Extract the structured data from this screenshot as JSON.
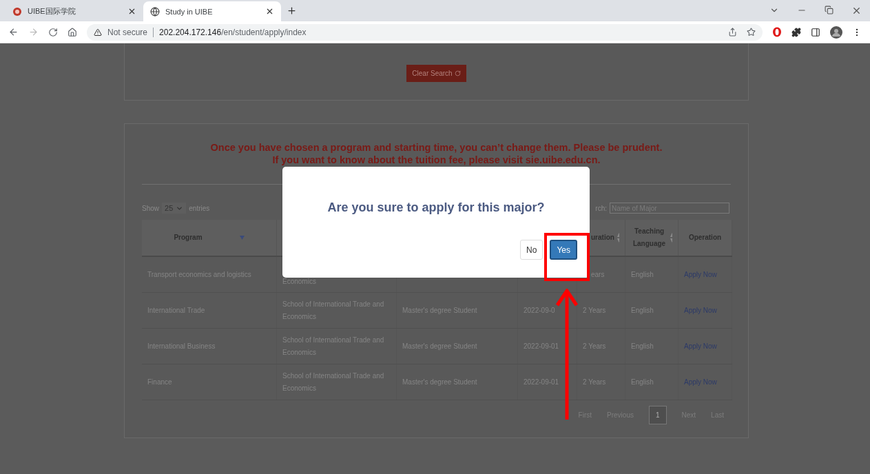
{
  "browser": {
    "tabs": [
      {
        "title": "UIBE国际学院",
        "selected": false
      },
      {
        "title": "Study in UIBE",
        "selected": true
      }
    ],
    "address": {
      "security": "Not secure",
      "host": "202.204.172.146",
      "path": "/en/student/apply/index"
    }
  },
  "page": {
    "clear_button": "Clear Search",
    "notice": [
      "Once you have chosen a program and starting time, you can’t change them. Please be prudent.",
      "If you want to know about the tuition fee, please visit sie.uibe.edu.cn."
    ],
    "controls": {
      "show_label": "Show",
      "page_length": "25",
      "entries_label": "entries",
      "search_label": "rch:",
      "search_placeholder": "Name of Major"
    },
    "columns": [
      {
        "label": "Program",
        "sorted": true
      },
      {},
      {},
      {},
      {
        "label": "uration",
        "sorted": false
      },
      {
        "label": "Teaching Language",
        "sorted": false
      },
      {
        "label": "Operation"
      }
    ],
    "rows": [
      [
        "Transport economics and logistics",
        "Economics",
        null,
        null,
        "ears",
        "English",
        "Apply Now"
      ],
      [
        "International Trade",
        "School of International Trade and Economics",
        "Master's degree Student",
        "2022-09-0",
        "2 Years",
        "English",
        "Apply Now"
      ],
      [
        "International Business",
        "School of International Trade and Economics",
        "Master's degree Student",
        "2022-09-01",
        "2 Years",
        "English",
        "Apply Now"
      ],
      [
        "Finance",
        "School of International Trade and Economics",
        "Master's degree Student",
        "2022-09-01",
        "2 Years",
        "English",
        "Apply Now"
      ]
    ],
    "pagination": {
      "first": "First",
      "previous": "Previous",
      "pages": [
        {
          "label": "1",
          "selected": true
        }
      ],
      "next": "Next",
      "last": "Last"
    }
  },
  "modal": {
    "question": "Are you sure to apply for this major?",
    "buttons": [
      {
        "label": "No",
        "kind": "default"
      },
      {
        "label": "Yes",
        "kind": "primary"
      }
    ]
  }
}
